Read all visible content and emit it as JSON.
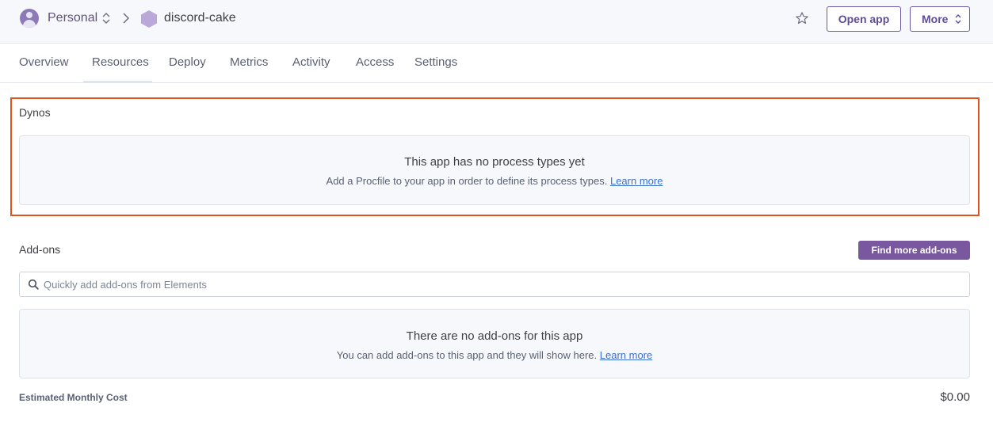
{
  "header": {
    "team_name": "Personal",
    "app_name": "discord-cake",
    "open_app_label": "Open app",
    "more_label": "More"
  },
  "tabs": [
    {
      "label": "Overview"
    },
    {
      "label": "Resources"
    },
    {
      "label": "Deploy"
    },
    {
      "label": "Metrics"
    },
    {
      "label": "Activity"
    },
    {
      "label": "Access"
    },
    {
      "label": "Settings"
    }
  ],
  "active_tab": "Resources",
  "dynos": {
    "title": "Dynos",
    "empty_title": "This app has no process types yet",
    "empty_desc": "Add a Procfile to your app in order to define its process types.",
    "learn_more": "Learn more"
  },
  "addons": {
    "title": "Add-ons",
    "find_button": "Find more add-ons",
    "search_placeholder": "Quickly add add-ons from Elements",
    "empty_title": "There are no add-ons for this app",
    "empty_desc": "You can add add-ons to this app and they will show here.",
    "learn_more": "Learn more"
  },
  "cost": {
    "label": "Estimated Monthly Cost",
    "value": "$0.00"
  },
  "colors": {
    "accent": "#79589f",
    "highlight": "#e0531d",
    "link": "#3b6fd1"
  }
}
